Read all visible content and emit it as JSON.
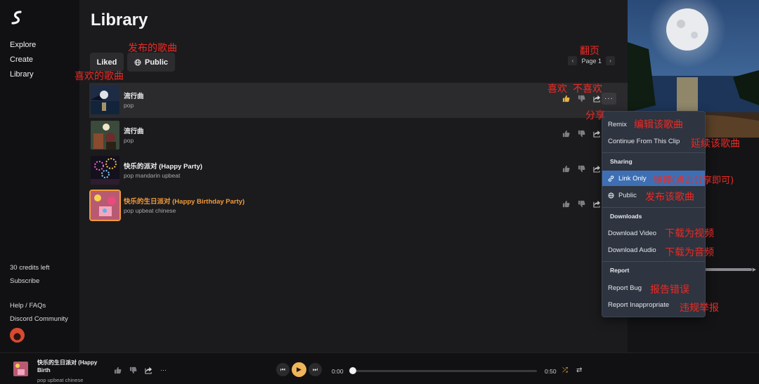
{
  "sidebar": {
    "nav": [
      "Explore",
      "Create",
      "Library"
    ],
    "credits": "30 credits left",
    "subscribe": "Subscribe",
    "help": "Help / FAQs",
    "discord": "Discord Community"
  },
  "main": {
    "title": "Library",
    "tabs": {
      "liked": "Liked",
      "public": "Public"
    },
    "pager": {
      "label": "Page 1"
    },
    "songs": [
      {
        "title": "流行曲",
        "tags": "pop",
        "liked": true
      },
      {
        "title": "流行曲",
        "tags": "pop",
        "liked": false
      },
      {
        "title": "快乐的派对 (Happy Party)",
        "tags": "pop mandarin upbeat",
        "liked": false
      },
      {
        "title": "快乐的生日派对 (Happy Birthday Party)",
        "tags": "pop upbeat chinese",
        "liked": false
      }
    ]
  },
  "menu": {
    "remix": "Remix",
    "continue": "Continue From This Clip",
    "sharing_header": "Sharing",
    "link_only": "Link Only",
    "public": "Public",
    "downloads_header": "Downloads",
    "download_video": "Download Video",
    "download_audio": "Download Audio",
    "report_header": "Report",
    "report_bug": "Report Bug",
    "report_inappropriate": "Report Inappropriate"
  },
  "annotations": {
    "public_songs": "发布的歌曲",
    "liked_songs": "喜欢的歌曲",
    "pagination": "翻页",
    "like": "喜欢",
    "dislike": "不喜欢",
    "share": "分享",
    "edit_song": "编辑该歌曲",
    "continue_song": "延续该歌曲",
    "link_only": "链接(点击分享即可)",
    "publish_song": "发布该歌曲",
    "download_video": "下载为视频",
    "download_audio": "下载为音频",
    "report_bug": "报告错误",
    "report_violation": "违规举报"
  },
  "player": {
    "title": "快乐的生日派对 (Happy Birth",
    "tags": "pop upbeat chinese",
    "current_time": "0:00",
    "duration": "0:50",
    "progress": 0
  },
  "colors": {
    "accent_orange": "#f39a3c",
    "menu_selected": "#3e6fb4",
    "annotation_red": "#ee2a24",
    "play_button": "#f0b45a"
  }
}
